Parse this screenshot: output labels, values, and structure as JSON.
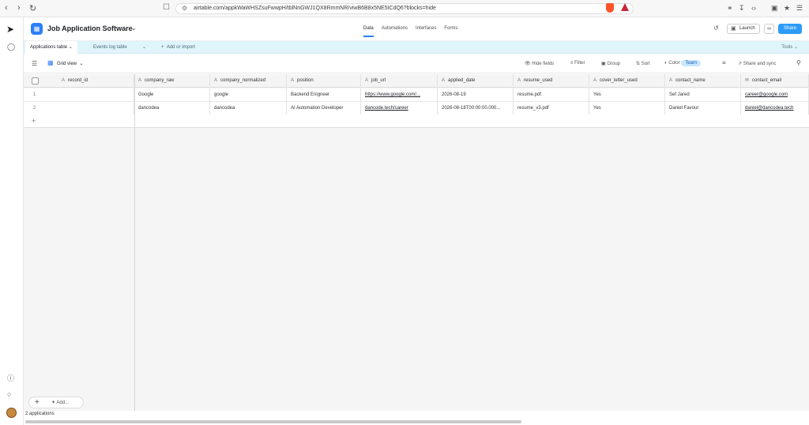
{
  "browser": {
    "url": "airtable.com/appkWaWHSZsuFwwpH/tblNnGWJ1QX8RmmNR/viwB6B8x5NE5ICdQ6?blocks=hide"
  },
  "app": {
    "base_name": "Job Application Software",
    "top_tabs": [
      "Data",
      "Automations",
      "Interfaces",
      "Forms"
    ],
    "launch_label": "Launch",
    "share_label": "Share"
  },
  "tables": {
    "active": "Applications table",
    "other": "Events log table",
    "add": "Add or import",
    "tools": "Tools"
  },
  "viewbar": {
    "view_name": "Grid view",
    "hide_fields": "Hide fields",
    "filter": "Filter",
    "group": "Group",
    "sort": "Sort",
    "color": "Color",
    "color_value": "Team",
    "share_sync": "Share and sync"
  },
  "columns": [
    "record_id",
    "company_raw",
    "company_normalized",
    "position",
    "job_url",
    "applied_date",
    "resume_used",
    "cover_letter_used",
    "contact_name",
    "contact_email"
  ],
  "rows": [
    {
      "num": "1",
      "record_id": "",
      "company_raw": "Google",
      "company_normalized": "google",
      "position": "Backend Enigneer",
      "job_url": "https://www.google.com/...",
      "applied_date": "2026-08-19",
      "resume_used": "resume.pdf",
      "cover_letter_used": "Yes",
      "contact_name": "Sef Jared",
      "contact_email": "career@google.com"
    },
    {
      "num": "2",
      "record_id": "",
      "company_raw": "dancodea",
      "company_normalized": "dancodea",
      "position": "AI Automation Developer",
      "job_url": "dancode.tech/career",
      "applied_date": "2026-08-18T00:00:00.000...",
      "resume_used": "resume_v3.pdf",
      "cover_letter_used": "Yes",
      "contact_name": "Daniel Favour",
      "contact_email": "daniel@dancodea.tech"
    }
  ],
  "footer": {
    "add_label": "Add...",
    "count": "2 applications"
  }
}
